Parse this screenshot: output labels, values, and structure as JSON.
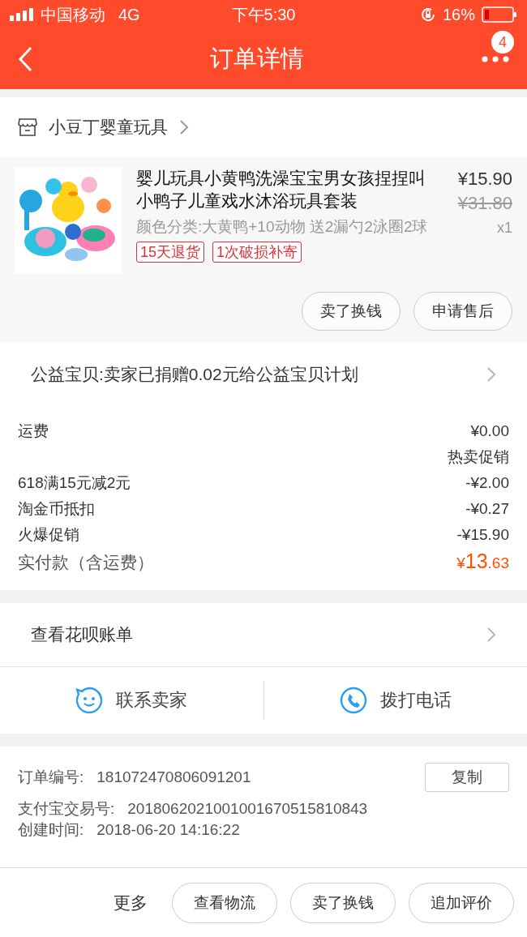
{
  "status_bar": {
    "carrier": "中国移动",
    "network": "4G",
    "time": "下午5:30",
    "battery": "16%"
  },
  "nav": {
    "title": "订单详情",
    "badge": "4"
  },
  "shop": {
    "name": "小豆丁婴童玩具"
  },
  "product": {
    "title": "婴儿玩具小黄鸭洗澡宝宝男女孩捏捏叫小鸭子儿童戏水沐浴玩具套装",
    "sku": "颜色分类:大黄鸭+10动物 送2漏勺2泳圈2球",
    "price": "¥15.90",
    "original_price": "¥31.80",
    "quantity": "x1",
    "tags": [
      "15天退货",
      "1次破损补寄"
    ],
    "buttons": [
      "卖了换钱",
      "申请售后"
    ]
  },
  "charity": {
    "text": "公益宝贝:卖家已捐赠0.02元给公益宝贝计划"
  },
  "fees": [
    {
      "label": "运费",
      "value": "¥0.00"
    },
    {
      "value": "热卖促销"
    },
    {
      "label": "618满15元减2元",
      "value": "-¥2.00"
    },
    {
      "label": "淘金币抵扣",
      "value": "-¥0.27"
    },
    {
      "label": "火爆促销",
      "value": "-¥15.90"
    }
  ],
  "total": {
    "label": "实付款（含运费）",
    "currency": "¥",
    "integer": "13",
    "decimal": ".63"
  },
  "huabei": {
    "text": "查看花呗账单"
  },
  "contact": [
    {
      "kind": "chat",
      "label": "联系卖家"
    },
    {
      "kind": "phone",
      "label": "拨打电话"
    }
  ],
  "info": {
    "rows": [
      {
        "label": "订单编号:",
        "value": "181072470806091201"
      },
      {
        "label": "支付宝交易号:",
        "value": "2018062021001001670515810843"
      },
      {
        "label": "创建时间:",
        "value": "2018-06-20 14:16:22"
      }
    ],
    "copy_button": "复制"
  },
  "bottom_bar": {
    "more": "更多",
    "buttons": [
      "查看物流",
      "卖了换钱",
      "追加评价"
    ]
  }
}
